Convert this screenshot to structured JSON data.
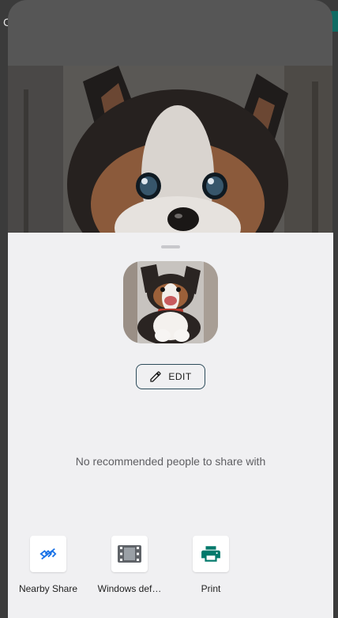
{
  "background_app": {
    "tab_initial": "C"
  },
  "sheet": {
    "edit_label": "EDIT",
    "no_recommendations": "No recommended people to share with",
    "targets": [
      {
        "label": "Nearby Share",
        "icon": "nearby-share-icon",
        "color": "#1a73e8"
      },
      {
        "label": "Windows def…",
        "icon": "film-icon",
        "color": "#5f6368"
      },
      {
        "label": "Print",
        "icon": "printer-icon",
        "color": "#00796b"
      }
    ]
  },
  "colors": {
    "sheet_background": "#f0f0f2",
    "accent_teal": "#00796b",
    "nearby_blue": "#1a73e8"
  }
}
